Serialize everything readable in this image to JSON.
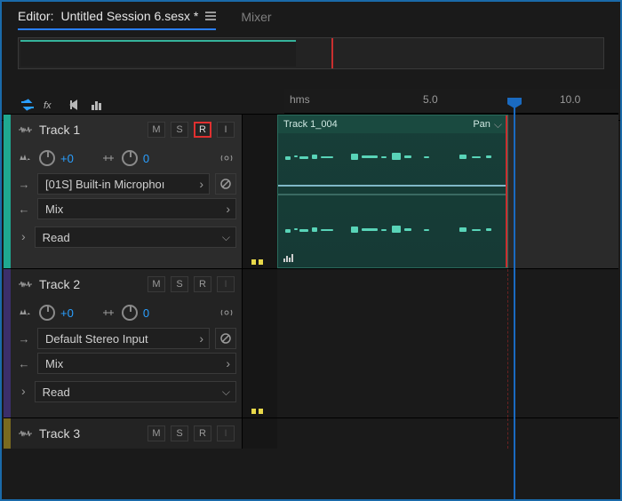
{
  "tabs": {
    "editor_prefix": "Editor:",
    "editor_file": "Untitled Session 6.sesx *",
    "mixer": "Mixer"
  },
  "ruler": {
    "unit": "hms",
    "ticks": [
      "5.0",
      "10.0"
    ]
  },
  "toolbar": {
    "left": [
      "swap-icon",
      "fx-icon",
      "send-icon",
      "eq-icon"
    ],
    "right": [
      "metronome-icon",
      "timer-icon",
      "snap-icon",
      "marker-icon"
    ]
  },
  "tracks": [
    {
      "name": "Track 1",
      "color": "c1",
      "armed": true,
      "m": "M",
      "s": "S",
      "r": "R",
      "i": "I",
      "vol": "+0",
      "pan": "0",
      "input": "[01S] Built-in Microphoı",
      "output": "Mix",
      "automation": "Read",
      "clip": {
        "name": "Track 1_004",
        "pan_label": "Pan"
      }
    },
    {
      "name": "Track 2",
      "color": "c2",
      "armed": false,
      "m": "M",
      "s": "S",
      "r": "R",
      "i": "I",
      "vol": "+0",
      "pan": "0",
      "input": "Default Stereo Input",
      "output": "Mix",
      "automation": "Read"
    },
    {
      "name": "Track 3",
      "color": "c3",
      "armed": false,
      "m": "M",
      "s": "S",
      "r": "R",
      "i": "I"
    }
  ]
}
